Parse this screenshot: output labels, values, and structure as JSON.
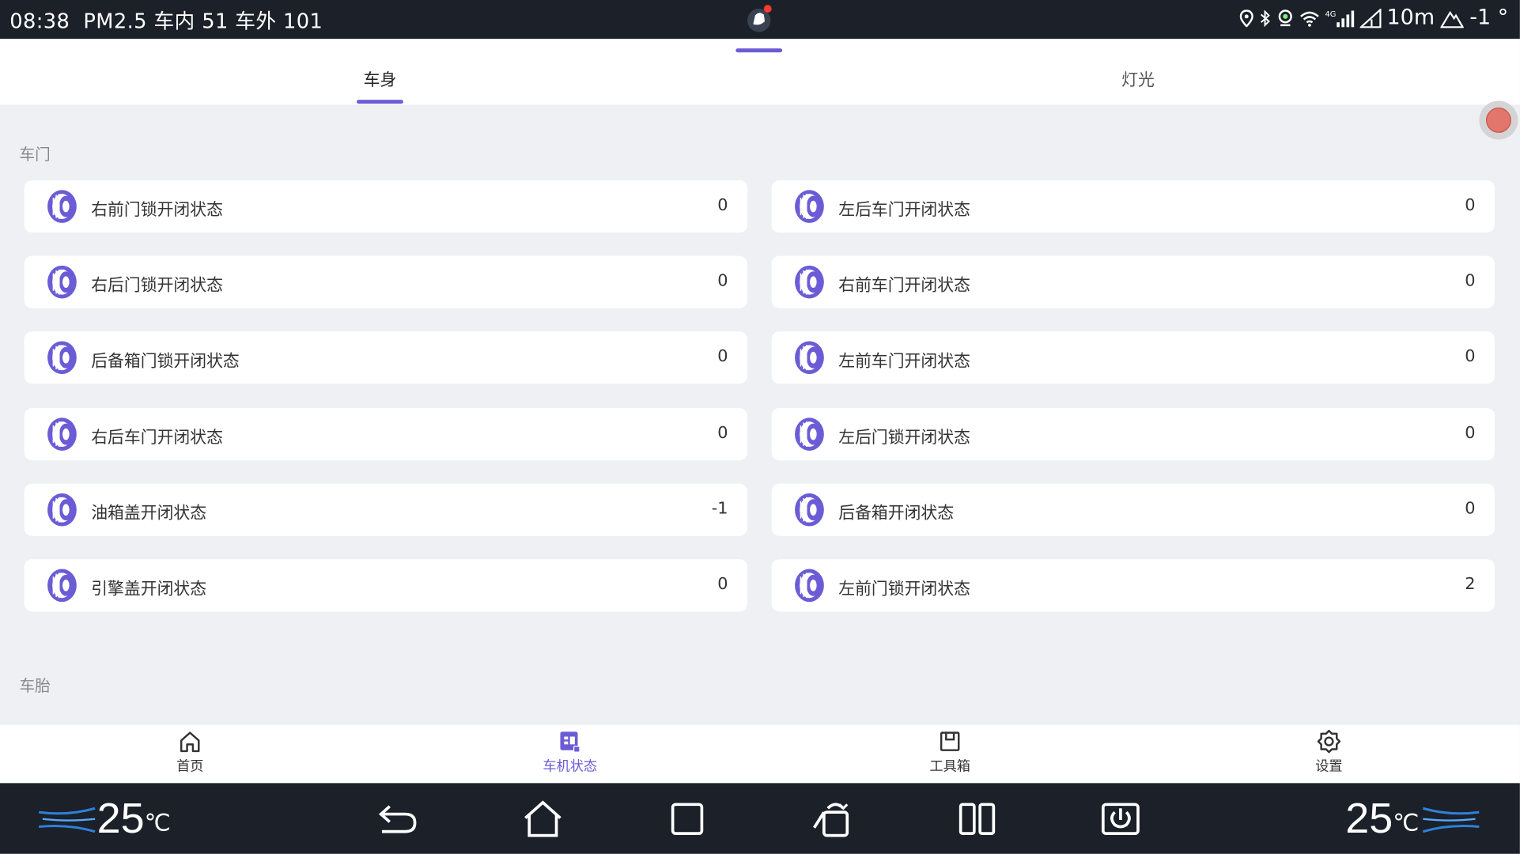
{
  "status_bar": {
    "time": "08:38",
    "pm25": "PM2.5 车内 51 车外 101",
    "right_text": "10m",
    "degrees": "-1 °",
    "icons": [
      "location-icon",
      "bluetooth-icon",
      "camera-icon",
      "wifi-icon",
      "4g-signal-icon",
      "cell-signal-icon",
      "altitude-icon"
    ]
  },
  "tabs": [
    {
      "label": "车身",
      "active": true
    },
    {
      "label": "灯光",
      "active": false
    }
  ],
  "sections": {
    "doors_title": "车门",
    "tires_title": "车胎"
  },
  "door_items": [
    {
      "label": "右前门锁开闭状态",
      "value": "0"
    },
    {
      "label": "左后车门开闭状态",
      "value": "0"
    },
    {
      "label": "右后门锁开闭状态",
      "value": "0"
    },
    {
      "label": "右前车门开闭状态",
      "value": "0"
    },
    {
      "label": "后备箱门锁开闭状态",
      "value": "0"
    },
    {
      "label": "左前车门开闭状态",
      "value": "0"
    },
    {
      "label": "右后车门开闭状态",
      "value": "0"
    },
    {
      "label": "左后门锁开闭状态",
      "value": "0"
    },
    {
      "label": "油箱盖开闭状态",
      "value": "-1"
    },
    {
      "label": "后备箱开闭状态",
      "value": "0"
    },
    {
      "label": "引擎盖开闭状态",
      "value": "0"
    },
    {
      "label": "左前门锁开闭状态",
      "value": "2"
    }
  ],
  "bottom_nav": [
    {
      "label": "首页",
      "icon": "home-icon",
      "active": false
    },
    {
      "label": "车机状态",
      "icon": "vehicle-status-icon",
      "active": true
    },
    {
      "label": "工具箱",
      "icon": "toolbox-icon",
      "active": false
    },
    {
      "label": "设置",
      "icon": "gear-icon",
      "active": false
    }
  ],
  "system_bar": {
    "left_temp": "25",
    "right_temp": "25",
    "unit": "℃",
    "buttons": [
      "back-icon",
      "home-icon",
      "recents-icon",
      "rotate-screen-icon",
      "split-screen-icon",
      "power-icon"
    ]
  },
  "colors": {
    "accent": "#6b5cd6",
    "bar_bg": "#1b2029",
    "page_bg": "#eef0f3"
  }
}
